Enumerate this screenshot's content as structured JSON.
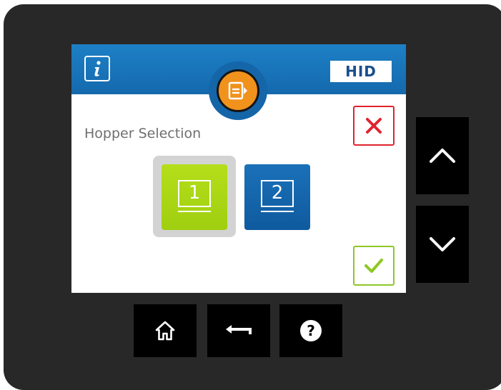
{
  "header": {
    "info_icon": "info-icon",
    "brand_logo_text": "HID",
    "badge_icon": "hopper-card-feed-icon",
    "brand_color": "#1569ad",
    "badge_color": "#f0921c"
  },
  "screen": {
    "title": "Hopper Selection",
    "cancel_icon": "close-icon",
    "confirm_icon": "checkmark-icon",
    "cancel_color": "#e0232e",
    "confirm_color": "#8ec825"
  },
  "hoppers": [
    {
      "label": "1",
      "selected": true,
      "color": "#a8d414"
    },
    {
      "label": "2",
      "selected": false,
      "color": "#1565a9"
    }
  ],
  "hardware_buttons": {
    "side": [
      {
        "icon": "chevron-up-icon"
      },
      {
        "icon": "chevron-down-icon"
      }
    ],
    "bottom": [
      {
        "icon": "home-icon"
      },
      {
        "icon": "back-arrow-icon"
      },
      {
        "icon": "help-icon",
        "glyph": "?"
      }
    ]
  }
}
